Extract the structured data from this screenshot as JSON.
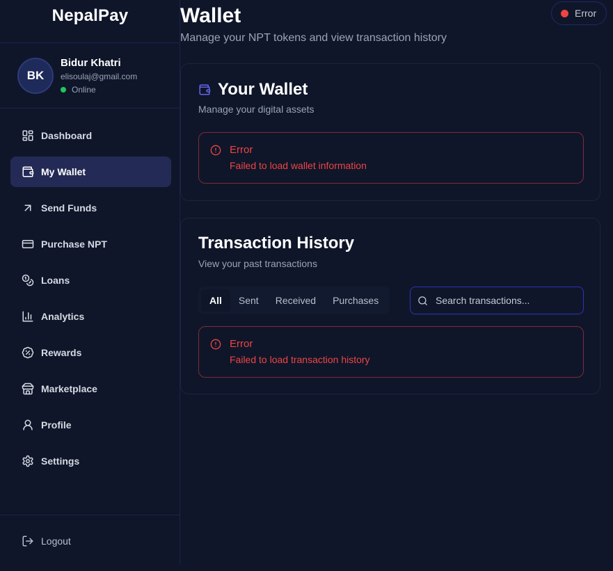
{
  "app": {
    "brand": "NepalPay"
  },
  "user": {
    "initials": "BK",
    "name": "Bidur Khatri",
    "email": "elisoulaj@gmail.com",
    "status": "Online"
  },
  "sidebar": {
    "items": [
      {
        "label": "Dashboard",
        "icon": "dashboard-icon"
      },
      {
        "label": "My Wallet",
        "icon": "wallet-icon",
        "active": true
      },
      {
        "label": "Send Funds",
        "icon": "arrow-up-right-icon"
      },
      {
        "label": "Purchase NPT",
        "icon": "credit-card-icon"
      },
      {
        "label": "Loans",
        "icon": "coins-icon"
      },
      {
        "label": "Analytics",
        "icon": "bar-chart-icon"
      },
      {
        "label": "Rewards",
        "icon": "badge-percent-icon"
      },
      {
        "label": "Marketplace",
        "icon": "store-icon"
      },
      {
        "label": "Profile",
        "icon": "user-icon"
      },
      {
        "label": "Settings",
        "icon": "gear-icon"
      }
    ],
    "logout": "Logout"
  },
  "header": {
    "title": "Wallet",
    "subtitle": "Manage your NPT tokens and view transaction history",
    "connection_status": "Error"
  },
  "wallet_card": {
    "title": "Your Wallet",
    "subtitle": "Manage your digital assets",
    "error_title": "Error",
    "error_message": "Failed to load wallet information"
  },
  "history_card": {
    "title": "Transaction History",
    "subtitle": "View your past transactions",
    "tabs": [
      "All",
      "Sent",
      "Received",
      "Purchases"
    ],
    "active_tab": "All",
    "search_placeholder": "Search transactions...",
    "error_title": "Error",
    "error_message": "Failed to load transaction history"
  },
  "colors": {
    "background": "#0f1629",
    "active_nav": "#232a55",
    "error": "#ef4444",
    "online": "#22c55e",
    "accent": "#6366f1"
  }
}
